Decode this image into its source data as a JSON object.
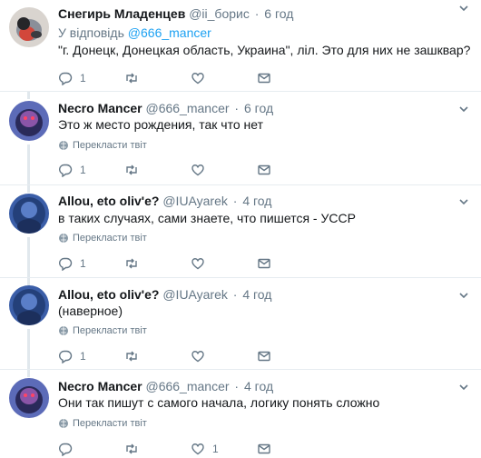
{
  "tweets": [
    {
      "name": "Снегирь Младенцев",
      "handle": "@ii_борис",
      "time": "6 год",
      "text": "\"г. Донецк, Донецкая область, Украина\", ліл. Это для них не зашквар?",
      "reply": "1",
      "retweet": "",
      "like": "",
      "avatar": "bird"
    },
    {
      "name": "Necro Mancer",
      "handle": "@666_mancer",
      "time": "6 год",
      "reply_prefix": "У відповідь",
      "reply_to": "@666_mancer",
      "text": "Это ж место рождения, так что нет",
      "translate": "Перекласти твіт",
      "reply": "1",
      "retweet": "",
      "like": "",
      "avatar": "purple"
    },
    {
      "name": "Allou, eto oliv'e?",
      "handle": "@IUAyarek",
      "time": "4 год",
      "text": "в таких случаях, сами знаете, что пишется - УССР",
      "translate": "Перекласти твіт",
      "reply": "1",
      "retweet": "",
      "like": "",
      "avatar": "blue"
    },
    {
      "name": "Allou, eto oliv'e?",
      "handle": "@IUAyarek",
      "time": "4 год",
      "text": "(наверное)",
      "translate": "Перекласти твіт",
      "reply": "1",
      "retweet": "",
      "like": "",
      "avatar": "blue"
    },
    {
      "name": "Necro Mancer",
      "handle": "@666_mancer",
      "time": "4 год",
      "text": "Они так пишут с самого начала, логику понять сложно",
      "translate": "Перекласти твіт",
      "reply": "",
      "retweet": "",
      "like": "1",
      "avatar": "purple"
    }
  ],
  "colors": {
    "muted": "#657786",
    "link": "#1da1f2",
    "line": "#e1e8ed",
    "divider": "#e6ecf0"
  }
}
